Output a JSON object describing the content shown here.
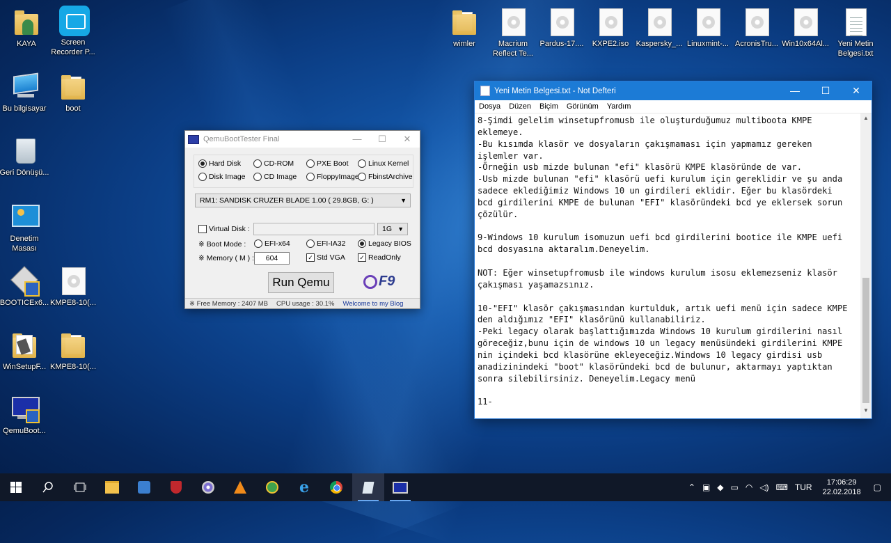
{
  "desktop": {
    "icons": [
      {
        "label": "KAYA",
        "icon": "user-folder-icon"
      },
      {
        "label": "Screen Recorder P...",
        "icon": "screen-recorder-icon"
      },
      {
        "label": "Bu bilgisayar",
        "icon": "computer-icon"
      },
      {
        "label": "boot",
        "icon": "folder-icon"
      },
      {
        "label": "Geri Dönüşü...",
        "icon": "recycle-bin-icon"
      },
      {
        "label": "Denetim Masası",
        "icon": "control-panel-icon"
      },
      {
        "label": "BOOTICEx6...",
        "icon": "bootice-icon"
      },
      {
        "label": "KMPE8-10(...",
        "icon": "disc-image-icon"
      },
      {
        "label": "WinSetupF...",
        "icon": "winsetup-folder-icon"
      },
      {
        "label": "KMPE8-10(...",
        "icon": "folder-icon"
      },
      {
        "label": "QemuBoot...",
        "icon": "qemu-icon"
      },
      {
        "label": "wimler",
        "icon": "folder-icon"
      },
      {
        "label": "Macrium Reflect Te...",
        "icon": "disc-image-icon"
      },
      {
        "label": "Pardus-17....",
        "icon": "disc-image-icon"
      },
      {
        "label": "KXPE2.iso",
        "icon": "disc-image-icon"
      },
      {
        "label": "Kaspersky_...",
        "icon": "disc-image-icon"
      },
      {
        "label": "Linuxmint-...",
        "icon": "disc-image-icon"
      },
      {
        "label": "AcronisTru...",
        "icon": "disc-image-icon"
      },
      {
        "label": "Win10x64Al...",
        "icon": "disc-image-icon"
      },
      {
        "label": "Yeni Metin Belgesi.txt",
        "icon": "text-file-icon"
      }
    ]
  },
  "qemu": {
    "title": "QemuBootTester Final",
    "boot_sources": [
      "Hard Disk",
      "CD-ROM",
      "PXE Boot",
      "Linux Kernel",
      "Disk Image",
      "CD Image",
      "FloppyImage",
      "FbinstArchive"
    ],
    "selected_source": "Hard Disk",
    "drive": "RM1: SANDISK CRUZER BLADE 1.00 ( 29.8GB, G: )",
    "virtual_disk_label": "Virtual Disk :",
    "virtual_disk_size": "1G",
    "boot_mode_label": "※ Boot Mode :",
    "boot_modes": [
      "EFI-x64",
      "EFI-IA32",
      "Legacy BIOS"
    ],
    "selected_boot_mode": "Legacy BIOS",
    "memory_label": "※ Memory ( M ) :",
    "memory_value": "604",
    "std_vga": "Std VGA",
    "readonly": "ReadOnly",
    "run_button": "Run Qemu",
    "logo": "F9",
    "status_memory": "※ Free Memory : 2407 MB",
    "status_cpu": "CPU usage : 30.1%",
    "status_blog": "Welcome to my Blog"
  },
  "notepad": {
    "title": "Yeni Metin Belgesi.txt - Not Defteri",
    "menu": [
      "Dosya",
      "Düzen",
      "Biçim",
      "Görünüm",
      "Yardım"
    ],
    "content": "8-Şimdi gelelim winsetupfromusb ile oluşturduğumuz multiboota KMPE\neklemeye.\n-Bu kısımda klasör ve dosyaların çakışmaması için yapmamız gereken\nişlemler var.\n-Örneğin usb mizde bulunan \"efi\" klasörü KMPE klasöründe de var.\n-Usb mizde bulunan \"efi\" klasörü uefi kurulum için gereklidir ve şu anda\nsadece eklediğimiz Windows 10 un girdileri eklidir. Eğer bu klasördeki\nbcd girdilerini KMPE de bulunan \"EFI\" klasöründeki bcd ye eklersek sorun\nçözülür.\n\n9-Windows 10 kurulum isomuzun uefi bcd girdilerini bootice ile KMPE uefi\nbcd dosyasına aktaralım.Deneyelim.\n\nNOT: Eğer winsetupfromusb ile windows kurulum isosu eklemezseniz klasör\nçakışması yaşamazsınız.\n\n10-\"EFI\" klasör çakışmasından kurtulduk, artık uefi menü için sadece KMPE\nden aldığımız \"EFI\" klasörünü kullanabiliriz.\n-Peki legacy olarak başlattığımızda Windows 10 kurulum girdilerini nasıl\ngöreceğiz,bunu için de windows 10 un legacy menüsündeki girdilerini KMPE\nnin içindeki bcd klasörüne ekleyeceğiz.Windows 10 legacy girdisi usb\nanadizinindeki \"boot\" klasöründeki bcd de bulunur, aktarmayı yaptıktan\nsonra silebilirsiniz. Deneyelim.Legacy menü\n\n11-"
  },
  "taskbar": {
    "lang": "TUR",
    "time": "17:06:29",
    "date": "22.02.2018"
  }
}
